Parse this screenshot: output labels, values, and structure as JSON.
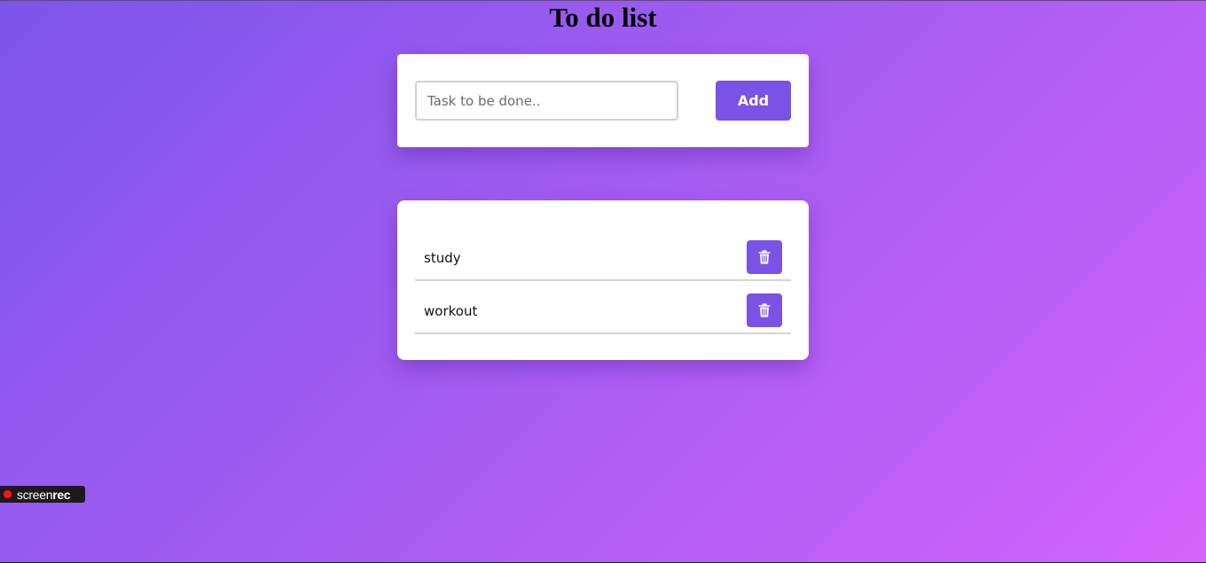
{
  "app": {
    "title": "To do list"
  },
  "input_section": {
    "placeholder": "Task to be done..",
    "value": "",
    "add_label": "Add"
  },
  "tasks": [
    {
      "label": "study",
      "delete_icon": "trash-icon"
    },
    {
      "label": "workout",
      "delete_icon": "trash-icon"
    }
  ],
  "recorder_badge": {
    "text_regular": "screen",
    "text_bold": "rec",
    "icon": "record-dot-icon"
  },
  "colors": {
    "accent": "#7a52e6",
    "background_start": "#7c55ea",
    "background_end": "#d363fb",
    "card": "#ffffff",
    "record_dot": "#e0201c"
  }
}
